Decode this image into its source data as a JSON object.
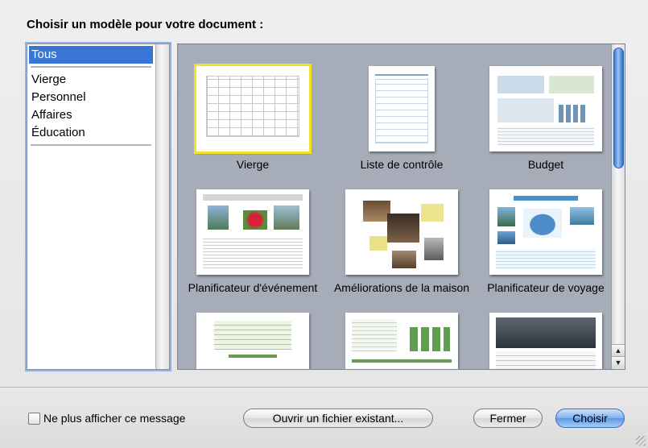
{
  "dialog": {
    "title": "Choisir un modèle pour votre document :"
  },
  "sidebar": {
    "items": [
      {
        "label": "Tous",
        "selected": true
      },
      {
        "label": "Vierge",
        "selected": false
      },
      {
        "label": "Personnel",
        "selected": false
      },
      {
        "label": "Affaires",
        "selected": false
      },
      {
        "label": "Éducation",
        "selected": false
      }
    ]
  },
  "templates": [
    {
      "label": "Vierge",
      "selected": true
    },
    {
      "label": "Liste de contrôle",
      "selected": false
    },
    {
      "label": "Budget",
      "selected": false
    },
    {
      "label": "Planificateur d'événement",
      "selected": false
    },
    {
      "label": "Améliorations de la maison",
      "selected": false
    },
    {
      "label": "Planificateur de voyage",
      "selected": false
    }
  ],
  "footer": {
    "checkbox_label": "Ne plus afficher ce message",
    "open_existing": "Ouvrir un fichier existant...",
    "close": "Fermer",
    "choose": "Choisir"
  },
  "colors": {
    "selection": "#3875d7",
    "thumb_highlight": "#f3e327",
    "pane_background": "#a7adb8"
  }
}
